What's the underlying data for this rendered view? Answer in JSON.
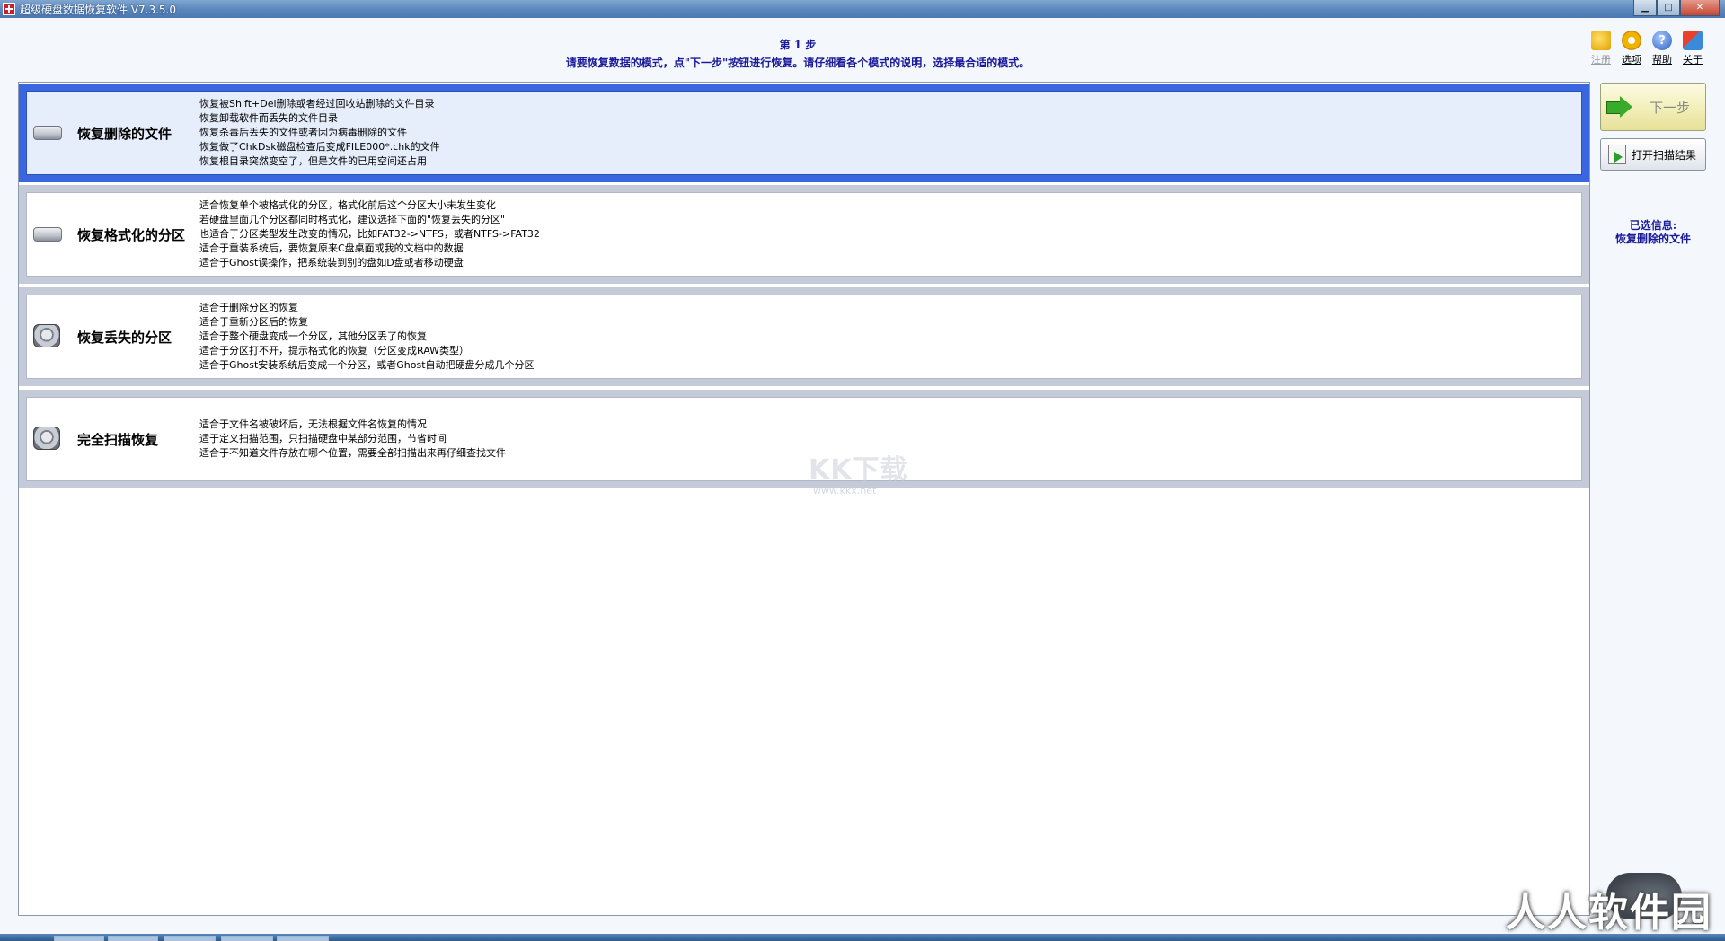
{
  "window": {
    "title": "超级硬盘数据恢复软件 V7.3.5.0",
    "min_label": "▁",
    "max_label": "□",
    "close_label": "✕"
  },
  "header": {
    "step_title": "第 1 步",
    "step_desc": "请要恢复数据的模式，点\"下一步\"按钮进行恢复。请仔细看各个模式的说明，选择最合适的模式。"
  },
  "toolbar": {
    "items": [
      {
        "label": "注册",
        "icon": "cart-icon",
        "disabled": true
      },
      {
        "label": "选项",
        "icon": "gear-icon",
        "disabled": false
      },
      {
        "label": "帮助",
        "icon": "help-icon",
        "disabled": false
      },
      {
        "label": "关于",
        "icon": "about-icon",
        "disabled": false
      }
    ]
  },
  "modes": [
    {
      "title": "恢复删除的文件",
      "selected": true,
      "icon": "disk-icon",
      "lines": [
        "恢复被Shift+Del删除或者经过回收站删除的文件目录",
        "恢复卸载软件而丢失的文件目录",
        "恢复杀毒后丢失的文件或者因为病毒删除的文件",
        "恢复做了ChkDsk磁盘检查后变成FILE000*.chk的文件",
        "恢复根目录突然变空了，但是文件的已用空间还占用"
      ]
    },
    {
      "title": "恢复格式化的分区",
      "selected": false,
      "icon": "disk-icon",
      "lines": [
        "适合恢复单个被格式化的分区，格式化前后这个分区大小未发生变化",
        "若硬盘里面几个分区都同时格式化，建议选择下面的\"恢复丢失的分区\"",
        "也适合于分区类型发生改变的情况，比如FAT32->NTFS，或者NTFS->FAT32",
        "适合于重装系统后，要恢复原来C盘桌面或我的文档中的数据",
        "适合于Ghost误操作，把系统装到别的盘如D盘或者移动硬盘"
      ]
    },
    {
      "title": "恢复丢失的分区",
      "selected": false,
      "icon": "hard-drive-icon",
      "lines": [
        "适合于删除分区的恢复",
        "适合于重新分区后的恢复",
        "适合于整个硬盘变成一个分区，其他分区丢了的恢复",
        "适合于分区打不开，提示格式化的恢复（分区变成RAW类型）",
        "适合于Ghost安装系统后变成一个分区，或者Ghost自动把硬盘分成几个分区"
      ]
    },
    {
      "title": "完全扫描恢复",
      "selected": false,
      "icon": "hard-drive-icon",
      "lines": [
        "适合于文件名被破坏后，无法根据文件名恢复的情况",
        "适于定义扫描范围，只扫描硬盘中某部分范围，节省时间",
        "适合于不知道文件存放在哪个位置，需要全部扫描出来再仔细查找文件"
      ]
    }
  ],
  "sidebar": {
    "next_label": "下一步",
    "open_results_label": "打开扫描结果",
    "selected_info_title": "已选信息:",
    "selected_info_value": "恢复删除的文件"
  },
  "watermarks": {
    "kk": "KK下载",
    "kk_url": "www.kkx.net",
    "rr": "人人软件园"
  }
}
